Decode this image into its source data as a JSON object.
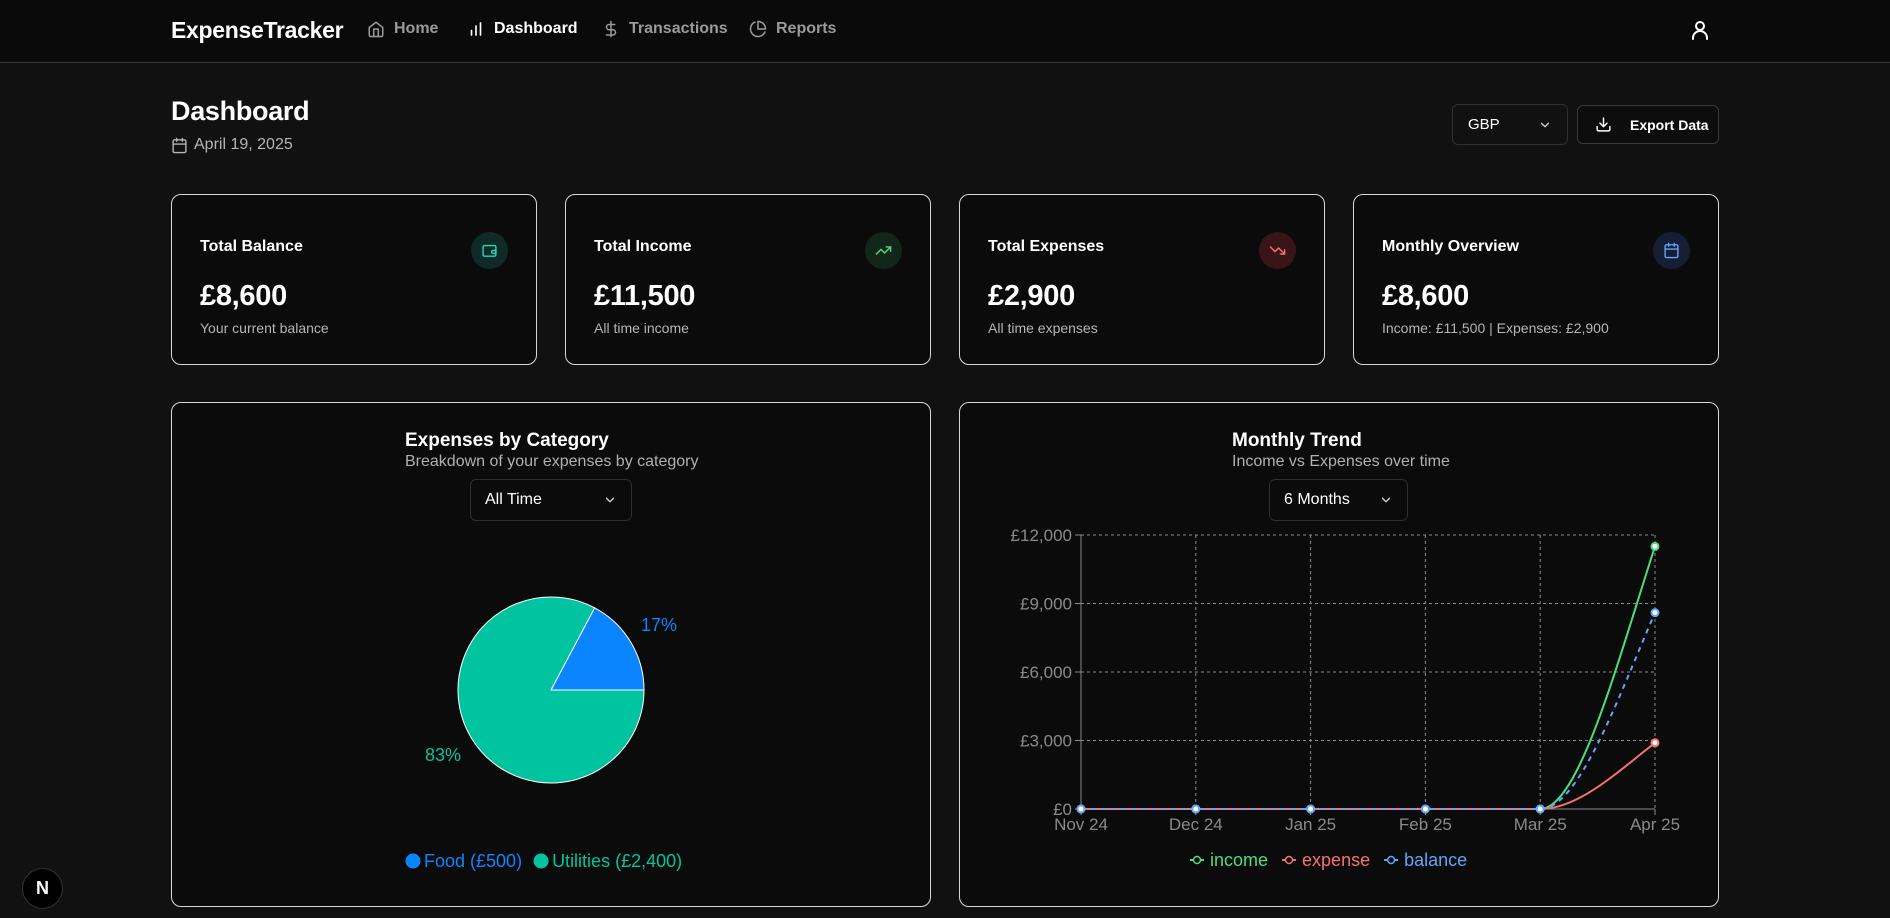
{
  "app": {
    "brand": "ExpenseTracker"
  },
  "nav": {
    "home": "Home",
    "dashboard": "Dashboard",
    "transactions": "Transactions",
    "reports": "Reports"
  },
  "header": {
    "title": "Dashboard",
    "date": "April 19, 2025",
    "currency": "GBP",
    "export_label": "Export Data"
  },
  "cards": [
    {
      "title": "Total Balance",
      "value": "£8,600",
      "subtitle": "Your current balance",
      "icon": "wallet-icon",
      "accent": "#2dd4bf"
    },
    {
      "title": "Total Income",
      "value": "£11,500",
      "subtitle": "All time income",
      "icon": "trending-up-icon",
      "accent": "#4ade80"
    },
    {
      "title": "Total Expenses",
      "value": "£2,900",
      "subtitle": "All time expenses",
      "icon": "trending-down-icon",
      "accent": "#f87171"
    },
    {
      "title": "Monthly Overview",
      "value": "£8,600",
      "subtitle": "Income: £11,500 | Expenses: £2,900",
      "icon": "calendar-icon",
      "accent": "#60a5fa"
    }
  ],
  "pie_panel": {
    "title": "Expenses by Category",
    "subtitle": "Breakdown of your expenses by category",
    "filter": "All Time",
    "chart_data": {
      "type": "pie",
      "slices": [
        {
          "label": "Food (£500)",
          "value": 500,
          "percent": "17%",
          "color": "#0a84ff"
        },
        {
          "label": "Utilities (£2,400)",
          "value": 2400,
          "percent": "83%",
          "color": "#00c49f"
        }
      ]
    }
  },
  "trend_panel": {
    "title": "Monthly Trend",
    "subtitle": "Income vs Expenses over time",
    "filter": "6 Months",
    "chart_data": {
      "type": "line",
      "x": [
        "Nov 24",
        "Dec 24",
        "Jan 25",
        "Feb 25",
        "Mar 25",
        "Apr 25"
      ],
      "ylim": [
        0,
        12000
      ],
      "yticks": [
        "£0",
        "£3,000",
        "£6,000",
        "£9,000",
        "£12,000"
      ],
      "ytick_values": [
        0,
        3000,
        6000,
        9000,
        12000
      ],
      "grid": true,
      "series": [
        {
          "name": "income",
          "values": [
            0,
            0,
            0,
            0,
            0,
            11500
          ],
          "color": "#4ade80",
          "dashed": false
        },
        {
          "name": "expense",
          "values": [
            0,
            0,
            0,
            0,
            0,
            2900
          ],
          "color": "#f87171",
          "dashed": false
        },
        {
          "name": "balance",
          "values": [
            0,
            0,
            0,
            0,
            0,
            8600
          ],
          "color": "#60a5fa",
          "dashed": true
        }
      ]
    }
  }
}
